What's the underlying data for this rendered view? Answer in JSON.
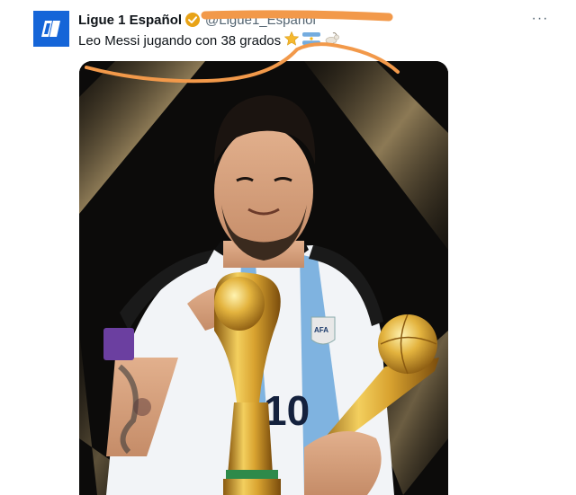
{
  "tweet": {
    "author_name": "Ligue 1 Español",
    "handle": "@Ligue1_Espanol",
    "text": "Leo Messi jugando con 38 grados",
    "emojis": [
      "star-emoji",
      "argentina-flag-emoji",
      "goat-emoji"
    ],
    "more_label": "···"
  },
  "media": {
    "jersey_number": "10",
    "badge_text": "AFA"
  },
  "colors": {
    "avatar": "#1565d8",
    "verified": "#e8a317",
    "scribble": "#f2994a",
    "gold": "#d9a330"
  }
}
